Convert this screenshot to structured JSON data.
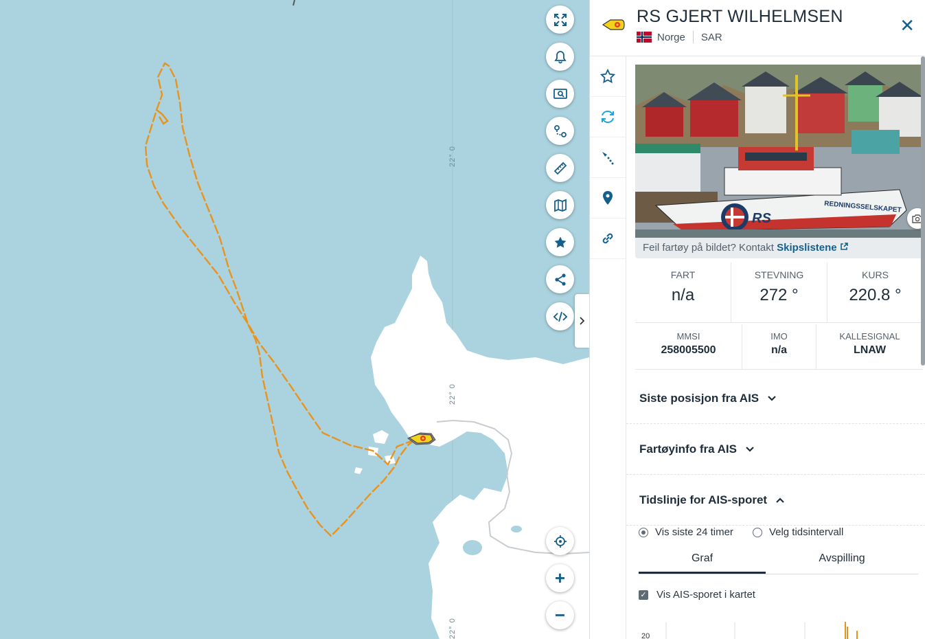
{
  "map": {
    "grid_label": "22° 0",
    "controls": [
      {
        "name": "fullscreen-button",
        "icon": "expand-icon"
      },
      {
        "name": "alerts-button",
        "icon": "bell-icon"
      },
      {
        "name": "search-map-button",
        "icon": "map-search-icon"
      },
      {
        "name": "route-button",
        "icon": "route-icon"
      },
      {
        "name": "measure-button",
        "icon": "ruler-icon"
      },
      {
        "name": "layers-button",
        "icon": "map-layers-icon"
      },
      {
        "name": "favorites-button",
        "icon": "star-icon"
      },
      {
        "name": "share-button",
        "icon": "share-icon"
      },
      {
        "name": "embed-button",
        "icon": "code-icon"
      }
    ],
    "zoom": {
      "locate": "locate-icon",
      "in": "+",
      "out": "−"
    },
    "track_color": "#e8931e"
  },
  "vessel": {
    "name": "RS GJERT WILHELMSEN",
    "country": "Norge",
    "type": "SAR",
    "photo_caption": "Feil fartøy på bildet? Kontakt",
    "photo_link": "Skipslistene",
    "stats": [
      {
        "label": "FART",
        "value": "n/a"
      },
      {
        "label": "STEVNING",
        "value": "272 °"
      },
      {
        "label": "KURS",
        "value": "220.8 °"
      }
    ],
    "ids": [
      {
        "label": "MMSI",
        "value": "258005500"
      },
      {
        "label": "IMO",
        "value": "n/a"
      },
      {
        "label": "KALLESIGNAL",
        "value": "LNAW"
      }
    ]
  },
  "sections": {
    "last_position": "Siste posisjon fra AIS",
    "vessel_info": "Fartøyinfo fra AIS",
    "timeline": "Tidslinje for AIS-sporet"
  },
  "timeline": {
    "radio_last24": "Vis siste 24 timer",
    "radio_interval": "Velg tidsintervall",
    "tab_graph": "Graf",
    "tab_playback": "Avspilling",
    "show_track": "Vis AIS-sporet i kartet",
    "chart_tick": "20"
  },
  "colors": {
    "accent": "#155f8c",
    "land": "#ffffff",
    "sea": "#aad3df",
    "track": "#e8931e"
  }
}
